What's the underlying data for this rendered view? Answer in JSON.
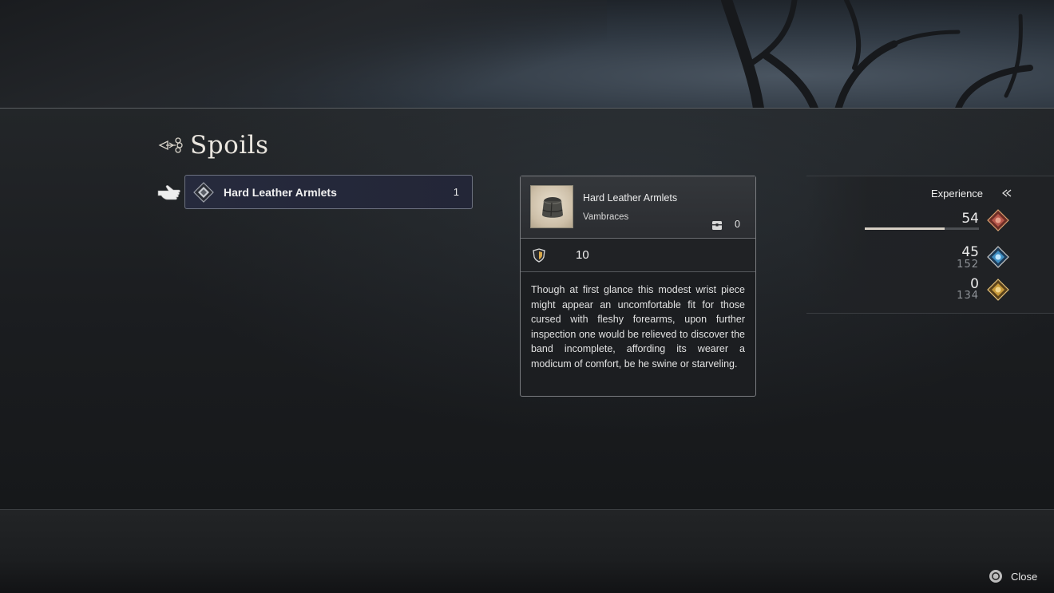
{
  "screen": {
    "title": "Spoils"
  },
  "spoils": {
    "items": [
      {
        "name": "Hard Leather Armlets",
        "quantity": "1",
        "selected": true
      }
    ]
  },
  "detail": {
    "name": "Hard Leather Armlets",
    "type": "Vambraces",
    "owned": "0",
    "defense": "10",
    "description": "Though at first glance this modest wrist piece might appear an uncomfortable fit for those cursed with fleshy forearms, upon further inspection one would be relieved to discover the band incomplete, affording its wearer a modicum of comfort, be he swine or starveling."
  },
  "experience": {
    "label": "Experience",
    "rows": [
      {
        "value": "54",
        "gem": "red",
        "bar_fill_fraction": 0.7
      },
      {
        "value": "45",
        "remaining": "152",
        "gem": "blue"
      },
      {
        "value": "0",
        "remaining": "134",
        "gem": "gold"
      }
    ]
  },
  "footer": {
    "close_label": "Close"
  },
  "colors": {
    "selected_row_bg": "#262a3d",
    "gem_red": "#b8574a",
    "gem_blue": "#3f8ec2",
    "gem_gold": "#c89a3a"
  },
  "icons": {
    "title": "ornament-icon",
    "pointer": "pointing-hand-icon",
    "item": "armor-diamond-icon",
    "owned": "chest-icon",
    "defense": "shield-icon",
    "experience": "arrow-icon",
    "close": "circle-button-icon"
  }
}
